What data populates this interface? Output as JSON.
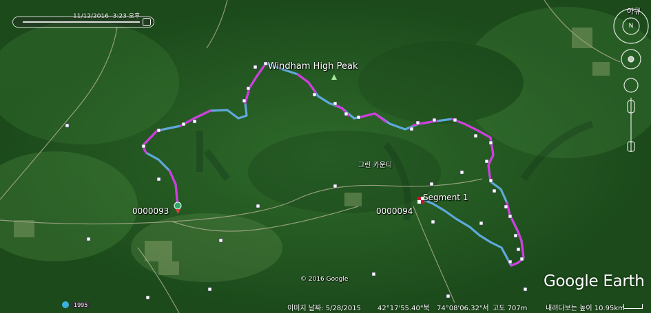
{
  "time_slider": {
    "date": "11/12/2016",
    "time": "3:23 오후"
  },
  "labels": {
    "peak": "Windham High Peak",
    "area": "그린 카운티",
    "segment": "Segment 1",
    "marker_start": "0000093",
    "marker_end": "0000094",
    "copyright": "© 2016 Google",
    "corner": "아큐"
  },
  "statusbar": {
    "year": "1995",
    "imagery_date": "이미지 날짜: 5/28/2015",
    "lat": "42°17'55.40\"북",
    "lon": "74°08'06.32\"서",
    "elevation": "고도  707m",
    "eye_alt": "내려다보는 높이  10.95km"
  },
  "logo": "Google Earth",
  "colors": {
    "track_pink": "#d838e0",
    "track_blue": "#5fa8dc",
    "forest": "#245a22"
  }
}
